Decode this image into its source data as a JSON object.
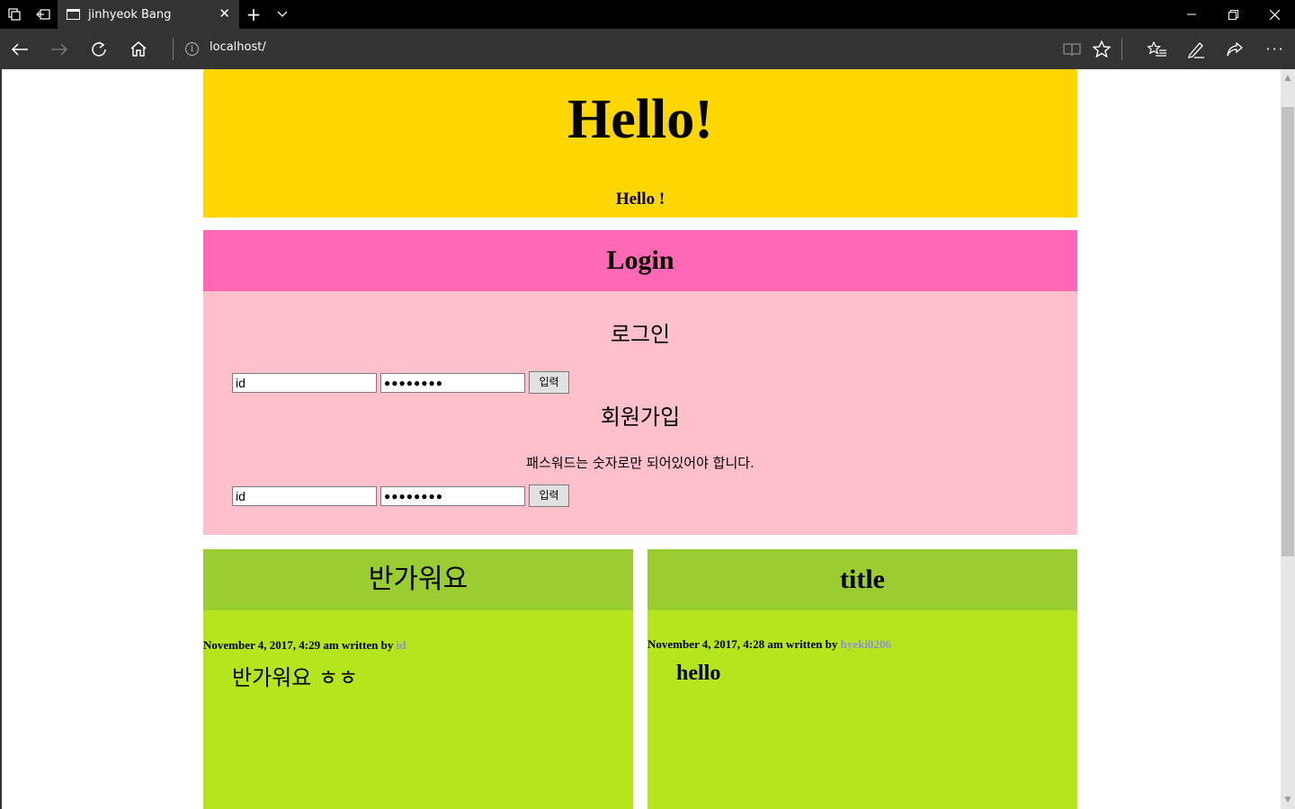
{
  "browser": {
    "tab_title": "jinhyeok Bang",
    "address": "localhost/"
  },
  "header": {
    "title": "Hello!",
    "subtitle": "Hello !"
  },
  "login": {
    "heading": "Login",
    "login_title": "로그인",
    "login_form": {
      "id_value": "id",
      "password_mask": "●●●●●●●●",
      "submit_label": "입력"
    },
    "signup_title": "회원가입",
    "signup_note": "패스워드는 숫자로만 되어있어야 합니다.",
    "signup_form": {
      "id_value": "id",
      "password_mask": "●●●●●●●●",
      "submit_label": "입력"
    }
  },
  "posts": [
    {
      "title": "반가워요",
      "meta_prefix": "November 4, 2017, 4:29 am written by ",
      "author": "id",
      "content": "반가워요 ㅎㅎ"
    },
    {
      "title": "title",
      "meta_prefix": "November 4, 2017, 4:28 am written by ",
      "author": "hyeki0206",
      "content": "hello"
    }
  ],
  "colors": {
    "header_bg": "#ffd700",
    "login_head_bg": "#ff69b4",
    "login_body_bg": "#ffc0cb",
    "post_head_bg": "#9acd32",
    "post_body_bg": "#b5e61d",
    "author_link": "#8f8fd6"
  },
  "icons": [
    "tab-manager-icon",
    "set-tabs-aside-icon",
    "page-icon",
    "close-tab-icon",
    "new-tab-icon",
    "tab-list-chevron-icon",
    "minimize-icon",
    "restore-icon",
    "close-window-icon",
    "back-icon",
    "forward-icon",
    "refresh-icon",
    "home-icon",
    "info-icon",
    "reading-view-icon",
    "favorite-star-icon",
    "favorites-hub-icon",
    "pen-icon",
    "share-icon",
    "more-icon"
  ]
}
